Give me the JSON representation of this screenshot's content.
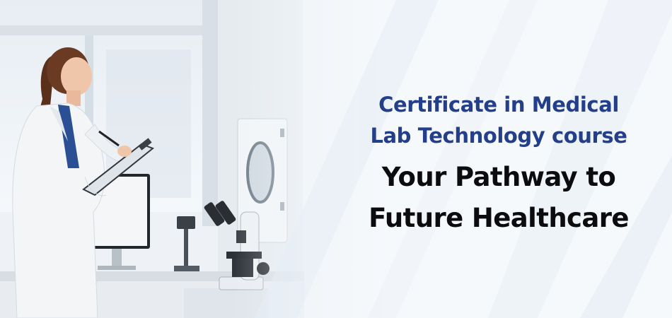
{
  "banner": {
    "course_title_line1": "Certificate in Medical",
    "course_title_line2": "Lab Technology course",
    "tagline_line1": "Your Pathway to",
    "tagline_line2": "Future Healthcare"
  },
  "colors": {
    "title_blue": "#243f8a",
    "tagline_black": "#0c0c0f",
    "background": "#f4f7fb"
  },
  "icons": [
    "lab-technician-photo",
    "microscope-icon",
    "monitor-icon",
    "clipboard-icon"
  ]
}
